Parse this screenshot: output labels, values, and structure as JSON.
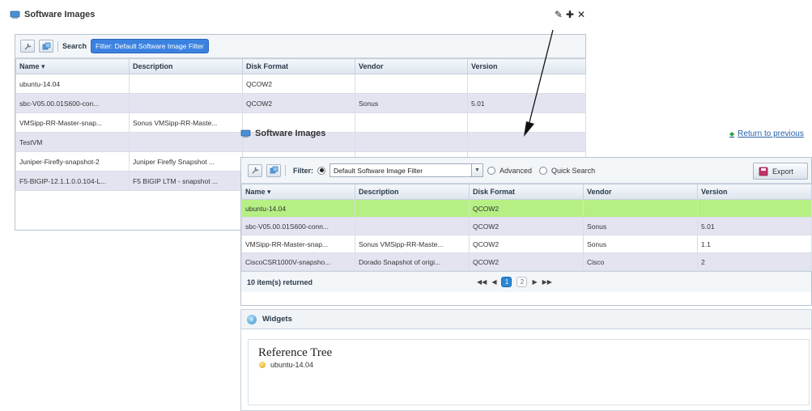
{
  "panel1": {
    "title": "Software Images",
    "toolbar": {
      "search_label": "Search",
      "filter_chip": "Filter: Default Software Image Filter"
    },
    "table": {
      "headers": [
        "Name",
        "Description",
        "Disk Format",
        "Vendor",
        "Version"
      ],
      "sorted_column": "Name",
      "rows": [
        [
          "ubuntu-14.04",
          "",
          "QCOW2",
          "",
          ""
        ],
        [
          "sbc-V05.00.01S600-con...",
          "",
          "QCOW2",
          "Sonus",
          "5.01"
        ],
        [
          "VMSipp-RR-Master-snap...",
          "Sonus VMSipp-RR-Maste...",
          "",
          "",
          ""
        ],
        [
          "TestVM",
          "",
          "",
          "",
          ""
        ],
        [
          "Juniper-Firefly-snapshot-2",
          "Juniper Firefly Snapshot ...",
          "",
          "",
          ""
        ],
        [
          "F5-BIGIP-12.1.1.0.0.104-L...",
          "F5 BIGIP LTM - snapshot ...",
          "",
          "",
          ""
        ]
      ]
    }
  },
  "panel2": {
    "title": "Software Images",
    "return_link": "Return to previous",
    "toolbar": {
      "filter_label": "Filter:",
      "filter_value": "Default Software Image Filter",
      "advanced_label": "Advanced",
      "quick_search_label": "Quick Search",
      "export_label": "Export"
    },
    "table": {
      "headers": [
        "Name",
        "Description",
        "Disk Format",
        "Vendor",
        "Version"
      ],
      "sorted_column": "Name",
      "rows": [
        [
          "ubuntu-14.04",
          "",
          "QCOW2",
          "",
          ""
        ],
        [
          "sbc-V05.00.01S600-conn...",
          "",
          "QCOW2",
          "Sonus",
          "5.01"
        ],
        [
          "VMSipp-RR-Master-snap...",
          "Sonus VMSipp-RR-Maste...",
          "QCOW2",
          "Sonus",
          "1.1"
        ],
        [
          "CiscoCSR1000V-snapsho...",
          "Dorado Snapshot of origi...",
          "QCOW2",
          "Cisco",
          "2"
        ]
      ]
    },
    "footer": {
      "count": "10 item(s) returned",
      "pages": [
        "1",
        "2"
      ],
      "current_page": "1"
    },
    "widgets": {
      "header": "Widgets",
      "reference_tree_title": "Reference Tree",
      "tree_item": "ubuntu-14.04"
    }
  },
  "colors": {
    "selected_row": "#b6ef84",
    "alt_row": "#e4e4f1",
    "filter_chip": "#3b82e0",
    "link": "#2a62a8"
  }
}
